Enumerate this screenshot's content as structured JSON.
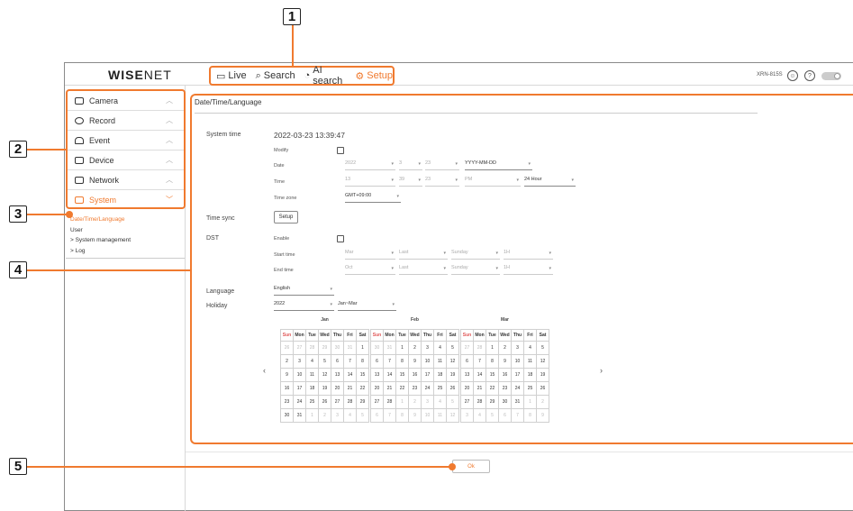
{
  "brand": {
    "logo_bold": "WISE",
    "logo_thin": "NET"
  },
  "nav": [
    {
      "label": "Live",
      "icon": "monitor-icon"
    },
    {
      "label": "Search",
      "icon": "search-icon"
    },
    {
      "label": "AI search",
      "icon": "ai-search-icon"
    },
    {
      "label": "Setup",
      "icon": "gear-icon"
    }
  ],
  "model": "XRN-815S",
  "menu": [
    {
      "label": "Camera",
      "icon": "camera-icon",
      "chevron": "︿"
    },
    {
      "label": "Record",
      "icon": "record-icon",
      "chevron": "︿"
    },
    {
      "label": "Event",
      "icon": "event-icon",
      "chevron": "︿"
    },
    {
      "label": "Device",
      "icon": "device-icon",
      "chevron": "︿"
    },
    {
      "label": "Network",
      "icon": "network-icon",
      "chevron": "︿"
    },
    {
      "label": "System",
      "icon": "system-icon",
      "chevron": "﹀"
    }
  ],
  "submenu": [
    "Date/Time/Language",
    "User",
    "> System management",
    "> Log"
  ],
  "page_title": "Date/Time/Language",
  "system_time": {
    "label": "System time",
    "value": "2022-03-23 13:39:47",
    "modify_label": "Modify",
    "date_label": "Date",
    "date_year": "2022",
    "date_month": "3",
    "date_day": "23",
    "date_format": "YYYY-MM-DD",
    "time_label": "Time",
    "time_h": "13",
    "time_m": "39",
    "time_s": "23",
    "time_ampm": "PM",
    "time_format": "24 Hour",
    "timezone_label": "Time zone",
    "timezone": "GMT+09:00"
  },
  "time_sync": {
    "label": "Time sync",
    "button": "Setup"
  },
  "dst": {
    "label": "DST",
    "enable_label": "Enable",
    "start_label": "Start time",
    "start": [
      "Mar",
      "Last",
      "Sunday",
      "1H"
    ],
    "end_label": "End time",
    "end": [
      "Oct",
      "Last",
      "Sunday",
      "1H"
    ]
  },
  "language": {
    "label": "Language",
    "value": "English"
  },
  "holiday": {
    "label": "Holiday",
    "year": "2022",
    "range": "Jan~Mar"
  },
  "calendar": {
    "prev": "‹",
    "next": "›",
    "days": [
      "Sun",
      "Mon",
      "Tue",
      "Wed",
      "Thu",
      "Fri",
      "Sat"
    ],
    "months": [
      {
        "name": "Jan",
        "weeks": [
          [
            {
              "d": "26",
              "dim": true
            },
            {
              "d": "27",
              "dim": true
            },
            {
              "d": "28",
              "dim": true
            },
            {
              "d": "29",
              "dim": true
            },
            {
              "d": "30",
              "dim": true
            },
            {
              "d": "31",
              "dim": true
            },
            {
              "d": "1"
            }
          ],
          [
            {
              "d": "2"
            },
            {
              "d": "3"
            },
            {
              "d": "4"
            },
            {
              "d": "5"
            },
            {
              "d": "6"
            },
            {
              "d": "7"
            },
            {
              "d": "8"
            }
          ],
          [
            {
              "d": "9"
            },
            {
              "d": "10"
            },
            {
              "d": "11"
            },
            {
              "d": "12"
            },
            {
              "d": "13"
            },
            {
              "d": "14"
            },
            {
              "d": "15"
            }
          ],
          [
            {
              "d": "16"
            },
            {
              "d": "17"
            },
            {
              "d": "18"
            },
            {
              "d": "19"
            },
            {
              "d": "20"
            },
            {
              "d": "21"
            },
            {
              "d": "22"
            }
          ],
          [
            {
              "d": "23"
            },
            {
              "d": "24"
            },
            {
              "d": "25"
            },
            {
              "d": "26"
            },
            {
              "d": "27"
            },
            {
              "d": "28"
            },
            {
              "d": "29"
            }
          ],
          [
            {
              "d": "30"
            },
            {
              "d": "31"
            },
            {
              "d": "1",
              "dim": true
            },
            {
              "d": "2",
              "dim": true
            },
            {
              "d": "3",
              "dim": true
            },
            {
              "d": "4",
              "dim": true
            },
            {
              "d": "5",
              "dim": true
            }
          ]
        ]
      },
      {
        "name": "Feb",
        "weeks": [
          [
            {
              "d": "30",
              "dim": true
            },
            {
              "d": "31",
              "dim": true
            },
            {
              "d": "1"
            },
            {
              "d": "2"
            },
            {
              "d": "3"
            },
            {
              "d": "4"
            },
            {
              "d": "5"
            }
          ],
          [
            {
              "d": "6"
            },
            {
              "d": "7"
            },
            {
              "d": "8"
            },
            {
              "d": "9"
            },
            {
              "d": "10"
            },
            {
              "d": "11"
            },
            {
              "d": "12"
            }
          ],
          [
            {
              "d": "13"
            },
            {
              "d": "14"
            },
            {
              "d": "15"
            },
            {
              "d": "16"
            },
            {
              "d": "17"
            },
            {
              "d": "18"
            },
            {
              "d": "19"
            }
          ],
          [
            {
              "d": "20"
            },
            {
              "d": "21"
            },
            {
              "d": "22"
            },
            {
              "d": "23"
            },
            {
              "d": "24"
            },
            {
              "d": "25"
            },
            {
              "d": "26"
            }
          ],
          [
            {
              "d": "27"
            },
            {
              "d": "28"
            },
            {
              "d": "1",
              "dim": true
            },
            {
              "d": "2",
              "dim": true
            },
            {
              "d": "3",
              "dim": true
            },
            {
              "d": "4",
              "dim": true
            },
            {
              "d": "5",
              "dim": true
            }
          ],
          [
            {
              "d": "6",
              "dim": true
            },
            {
              "d": "7",
              "dim": true
            },
            {
              "d": "8",
              "dim": true
            },
            {
              "d": "9",
              "dim": true
            },
            {
              "d": "10",
              "dim": true
            },
            {
              "d": "11",
              "dim": true
            },
            {
              "d": "12",
              "dim": true
            }
          ]
        ]
      },
      {
        "name": "Mar",
        "weeks": [
          [
            {
              "d": "27",
              "dim": true
            },
            {
              "d": "28",
              "dim": true
            },
            {
              "d": "1"
            },
            {
              "d": "2"
            },
            {
              "d": "3"
            },
            {
              "d": "4"
            },
            {
              "d": "5"
            }
          ],
          [
            {
              "d": "6"
            },
            {
              "d": "7"
            },
            {
              "d": "8"
            },
            {
              "d": "9"
            },
            {
              "d": "10"
            },
            {
              "d": "11"
            },
            {
              "d": "12"
            }
          ],
          [
            {
              "d": "13"
            },
            {
              "d": "14"
            },
            {
              "d": "15"
            },
            {
              "d": "16"
            },
            {
              "d": "17"
            },
            {
              "d": "18"
            },
            {
              "d": "19"
            }
          ],
          [
            {
              "d": "20"
            },
            {
              "d": "21"
            },
            {
              "d": "22"
            },
            {
              "d": "23"
            },
            {
              "d": "24"
            },
            {
              "d": "25"
            },
            {
              "d": "26"
            }
          ],
          [
            {
              "d": "27"
            },
            {
              "d": "28"
            },
            {
              "d": "29"
            },
            {
              "d": "30"
            },
            {
              "d": "31"
            },
            {
              "d": "1",
              "dim": true
            },
            {
              "d": "2",
              "dim": true
            }
          ],
          [
            {
              "d": "3",
              "dim": true
            },
            {
              "d": "4",
              "dim": true
            },
            {
              "d": "5",
              "dim": true
            },
            {
              "d": "6",
              "dim": true
            },
            {
              "d": "7",
              "dim": true
            },
            {
              "d": "8",
              "dim": true
            },
            {
              "d": "9",
              "dim": true
            }
          ]
        ]
      }
    ]
  },
  "ok_button": "Ok",
  "callouts": [
    "1",
    "2",
    "3",
    "4",
    "5"
  ],
  "accent_color": "#f07a2f",
  "sunday_color": "#e05555"
}
